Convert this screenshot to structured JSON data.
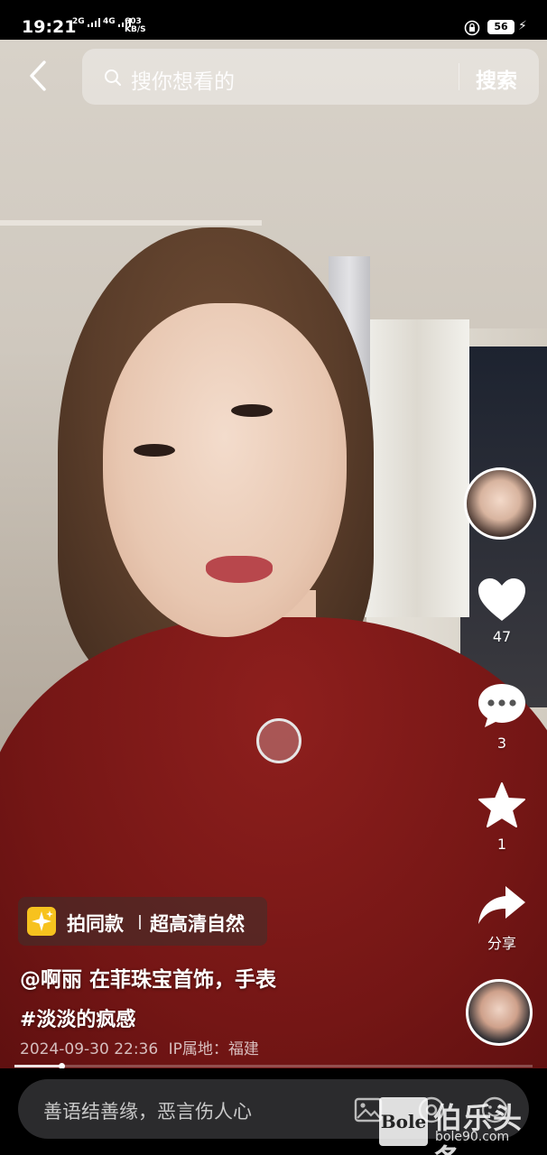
{
  "status_bar": {
    "time": "19:21",
    "network_left": "2G",
    "network_right": "4G",
    "net_speed_value": "603",
    "net_speed_unit": "KB/S",
    "battery": "56"
  },
  "top": {
    "search_placeholder": "搜你想看的",
    "search_button": "搜索"
  },
  "actions": {
    "like_count": "47",
    "comment_count": "3",
    "favorite_count": "1",
    "share_label": "分享"
  },
  "template_chip": {
    "label": "拍同款",
    "tag": "超高清自然"
  },
  "post": {
    "caption": "@啊丽 在菲珠宝首饰，手表",
    "hashtag": "#淡淡的疯感",
    "datetime": "2024-09-30 22:36",
    "location": "IP属地：福建"
  },
  "progress": {
    "fraction": 0.09
  },
  "comment_bar": {
    "placeholder": "善语结善缘，恶言伤人心"
  },
  "watermark": {
    "logo_text": "Bole",
    "title": "伯乐头条",
    "url": "bole90.com"
  },
  "colors": {
    "shirt": "#741615",
    "accent_yellow": "#f7c21e",
    "comment_box": "#2b2b2d"
  }
}
